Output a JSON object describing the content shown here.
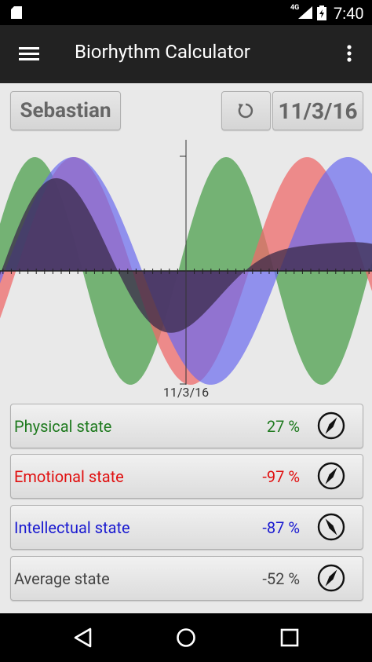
{
  "status_bar": {
    "network": "4G",
    "time": "7:40"
  },
  "app_bar": {
    "title": "Biorhythm Calculator"
  },
  "controls": {
    "name": "Sebastian",
    "date": "11/3/16"
  },
  "chart": {
    "date_label": "11/3/16",
    "colors": {
      "physical": "#5fa85f",
      "emotional": "#ee6a6a",
      "intellectual": "#6a6aee",
      "average": "#3a2a4a"
    }
  },
  "states": [
    {
      "label": "Physical state",
      "value": "27 %",
      "color": "#1f7a1f"
    },
    {
      "label": "Emotional state",
      "value": "-97 %",
      "color": "#e01010"
    },
    {
      "label": "Intellectual state",
      "value": "-87 %",
      "color": "#1a1ad0"
    },
    {
      "label": "Average state",
      "value": "-52 %",
      "color": "#444444"
    }
  ],
  "icons": {
    "menu": "hamburger-icon",
    "more": "overflow-menu-icon",
    "refresh": "refresh-icon",
    "compass": "compass-icon",
    "back": "back-icon",
    "home": "home-icon",
    "recents": "recents-icon"
  }
}
